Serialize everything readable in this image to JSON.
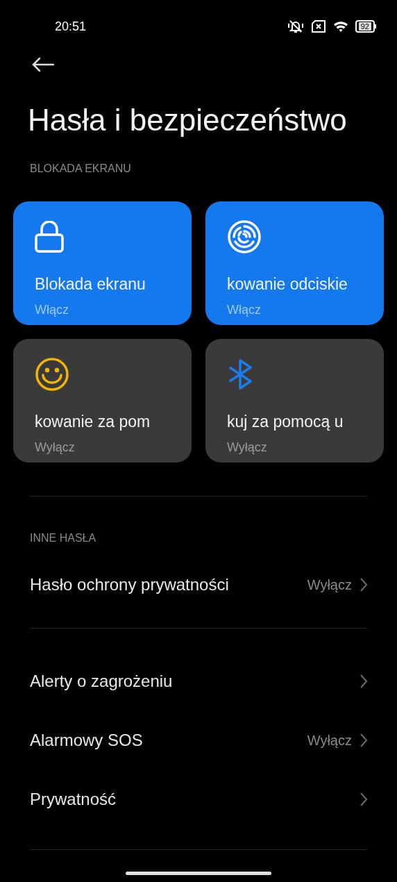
{
  "status_bar": {
    "time": "20:51",
    "battery": "92"
  },
  "title": "Hasła i bezpieczeństwo",
  "screen_lock": {
    "heading": "BLOKADA EKRANU",
    "cards": [
      {
        "kind": "lock",
        "title": "Blokada ekranu",
        "status": "Włącz",
        "on": true
      },
      {
        "kind": "fingerprint",
        "title": "kowanie odciskie",
        "status": "Włącz",
        "on": true
      },
      {
        "kind": "face",
        "title": "kowanie za pom",
        "status": "Wyłącz",
        "on": false
      },
      {
        "kind": "bluetooth",
        "title": "kuj za pomocą u",
        "status": "Wyłącz",
        "on": false
      }
    ]
  },
  "other_passwords": {
    "heading": "INNE HASŁA",
    "rows": [
      {
        "label": "Hasło ochrony prywatności",
        "value": "Wyłącz"
      }
    ]
  },
  "more": {
    "rows": [
      {
        "label": "Alerty o zagrożeniu"
      },
      {
        "label": "Alarmowy SOS",
        "value": "Wyłącz"
      },
      {
        "label": "Prywatność"
      }
    ]
  }
}
